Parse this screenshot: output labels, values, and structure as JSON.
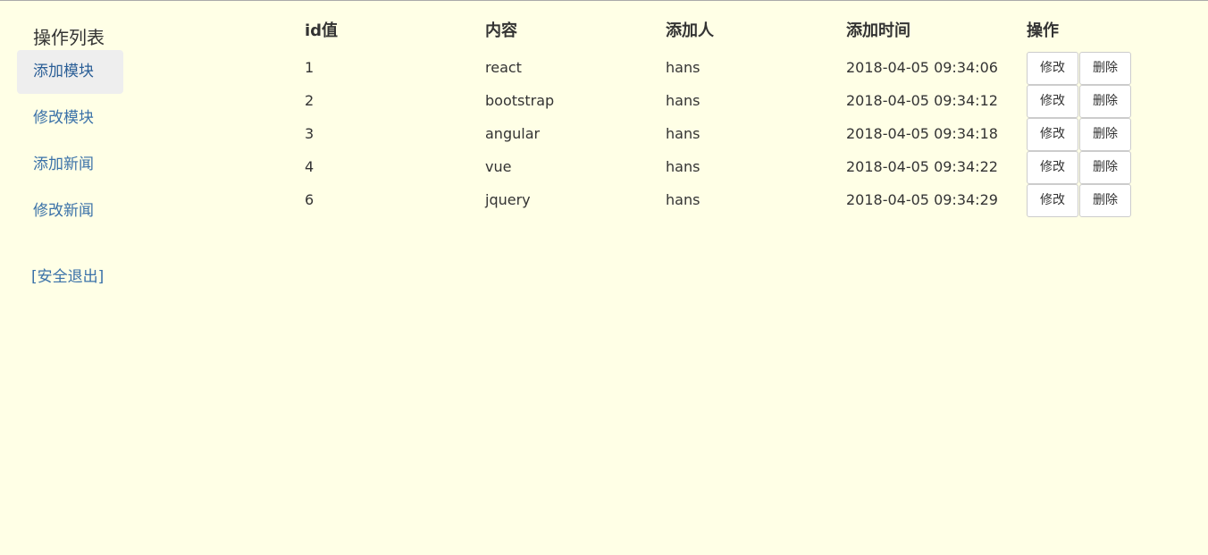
{
  "sidebar": {
    "title": "操作列表",
    "items": [
      {
        "label": "添加模块",
        "active": true
      },
      {
        "label": "修改模块",
        "active": false
      },
      {
        "label": "添加新闻",
        "active": false
      },
      {
        "label": "修改新闻",
        "active": false
      }
    ],
    "logout_label": "[安全退出]"
  },
  "table": {
    "headers": [
      "id值",
      "内容",
      "添加人",
      "添加时间",
      "操作"
    ],
    "rows": [
      {
        "id": "1",
        "content": "react",
        "author": "hans",
        "time": "2018-04-05 09:34:06"
      },
      {
        "id": "2",
        "content": "bootstrap",
        "author": "hans",
        "time": "2018-04-05 09:34:12"
      },
      {
        "id": "3",
        "content": "angular",
        "author": "hans",
        "time": "2018-04-05 09:34:18"
      },
      {
        "id": "4",
        "content": "vue",
        "author": "hans",
        "time": "2018-04-05 09:34:22"
      },
      {
        "id": "6",
        "content": "jquery",
        "author": "hans",
        "time": "2018-04-05 09:34:29"
      }
    ],
    "edit_label": "修改",
    "delete_label": "删除"
  },
  "colors": {
    "background": "#ffffe6",
    "link": "#3a71a8",
    "active_bg": "#eeeeee"
  }
}
